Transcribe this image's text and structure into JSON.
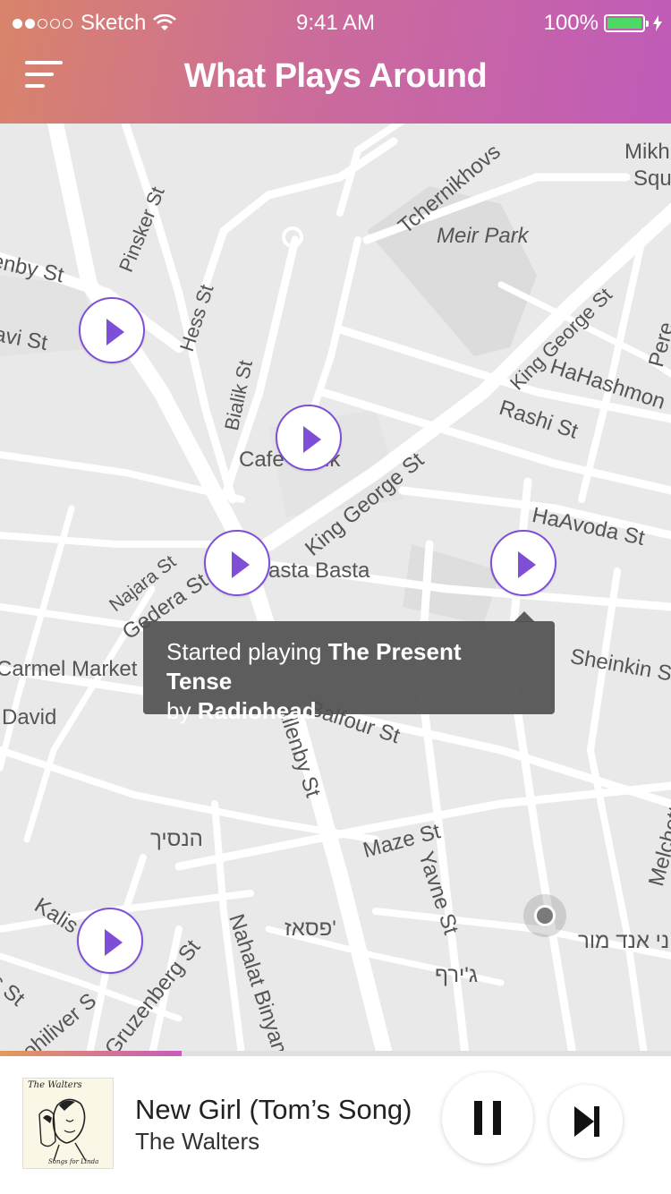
{
  "status_bar": {
    "carrier": "Sketch",
    "time": "9:41 AM",
    "battery": "100%"
  },
  "header": {
    "title": "What Plays Around",
    "menu_icon": "hamburger-menu-icon"
  },
  "map": {
    "labels": {
      "pinsker": "Pinsker St",
      "tchernikhovsky": "Tchernikhovs",
      "mikh": "Mikh",
      "squ": "Squ",
      "meir_park": "Meir Park",
      "enby": "enby St",
      "avi": "avi St",
      "hess": "Hess St",
      "king_george_ne": "King George St",
      "hahashmonaim": "HaHashmon",
      "pere": "Pere",
      "bialik": "Bialik St",
      "rashi": "Rashi St",
      "cafe": "Cafe",
      "cafe_tail": "ik",
      "king_george_mid": "King George St",
      "haavoda": "HaAvoda St",
      "najara": "Najara St",
      "gedera": "Gedera St",
      "basta": "asta Basta",
      "carmel_market": "Carmel Market",
      "sheinkin": "Sheinkin S",
      "david": "David",
      "balfour": "Balfour St",
      "allenby": "Allenby St",
      "hanasich": "הנסיך",
      "maze": "Maze St",
      "yavne": "Yavne St",
      "melchett": "Melchett",
      "kalis": "Kalis",
      "pasaz": "פסאז'",
      "ani_and_mor": "ני אנד מור",
      "ts": "ts St",
      "mohiliver": "ohiliver S",
      "nahalat_binyamin": "Nahalat Binyan",
      "gruzenberg": "Gruzenberg St",
      "jiraf": "ג'ירף"
    }
  },
  "toast": {
    "prefix": "Started playing ",
    "song": "The Present Tense",
    "by": "by ",
    "artist": "Radiohead"
  },
  "player": {
    "progress": 0.27,
    "song_title": "New Girl (Tom’s Song)",
    "artist": "The Walters",
    "album_title": "The Walters",
    "album_subtitle": "Songs for Linda",
    "pause_icon": "pause-icon",
    "next_icon": "skip-next-icon"
  },
  "colors": {
    "header_start": "#d9846a",
    "header_end": "#c05bb8",
    "marker_accent": "#7e4fd6",
    "battery_green": "#4cd964"
  }
}
